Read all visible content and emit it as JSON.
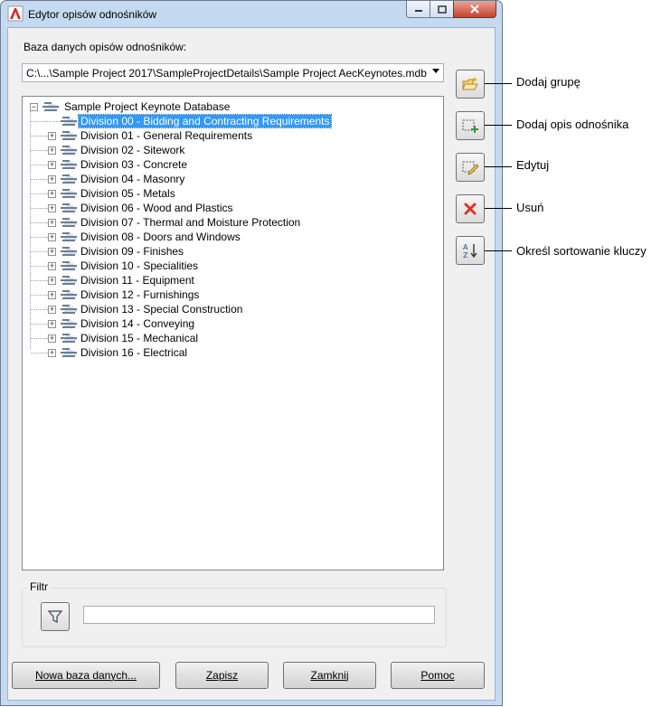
{
  "window": {
    "title": "Edytor opisów odnośników"
  },
  "database": {
    "label": "Baza danych opisów odnośników:",
    "selected_path": "C:\\...\\Sample Project 2017\\SampleProjectDetails\\Sample Project AecKeynotes.mdb"
  },
  "tree": {
    "root": "Sample Project Keynote Database",
    "selected_index": 0,
    "items": [
      "Division 00 - Bidding and Contracting Requirements",
      "Division 01 - General Requirements",
      "Division 02 - Sitework",
      "Division 03 - Concrete",
      "Division 04 - Masonry",
      "Division 05 - Metals",
      "Division 06 - Wood and Plastics",
      "Division 07 - Thermal and Moisture Protection",
      "Division 08 - Doors and Windows",
      "Division 09 - Finishes",
      "Division 10 - Specialities",
      "Division 11 - Equipment",
      "Division 12 - Furnishings",
      "Division 13 - Special Construction",
      "Division 14 - Conveying",
      "Division 15 - Mechanical",
      "Division 16 - Electrical"
    ]
  },
  "callouts": {
    "add_group": "Dodaj grupę",
    "add_keynote": "Dodaj opis odnośnika",
    "edit": "Edytuj",
    "delete": "Usuń",
    "sort": "Określ sortowanie kluczy"
  },
  "filter": {
    "label": "Filtr",
    "value": ""
  },
  "buttons": {
    "new_db": "Nowa baza danych...",
    "save": "Zapisz",
    "close": "Zamknij",
    "help": "Pomoc"
  },
  "icons": {
    "add_group": "folder-add-icon",
    "add_keynote": "add-keynote-icon",
    "edit": "edit-pencil-icon",
    "delete": "delete-x-icon",
    "sort": "sort-az-icon",
    "filter": "funnel-icon"
  },
  "colors": {
    "selection": "#3399ff",
    "delete": "#e0302a"
  }
}
